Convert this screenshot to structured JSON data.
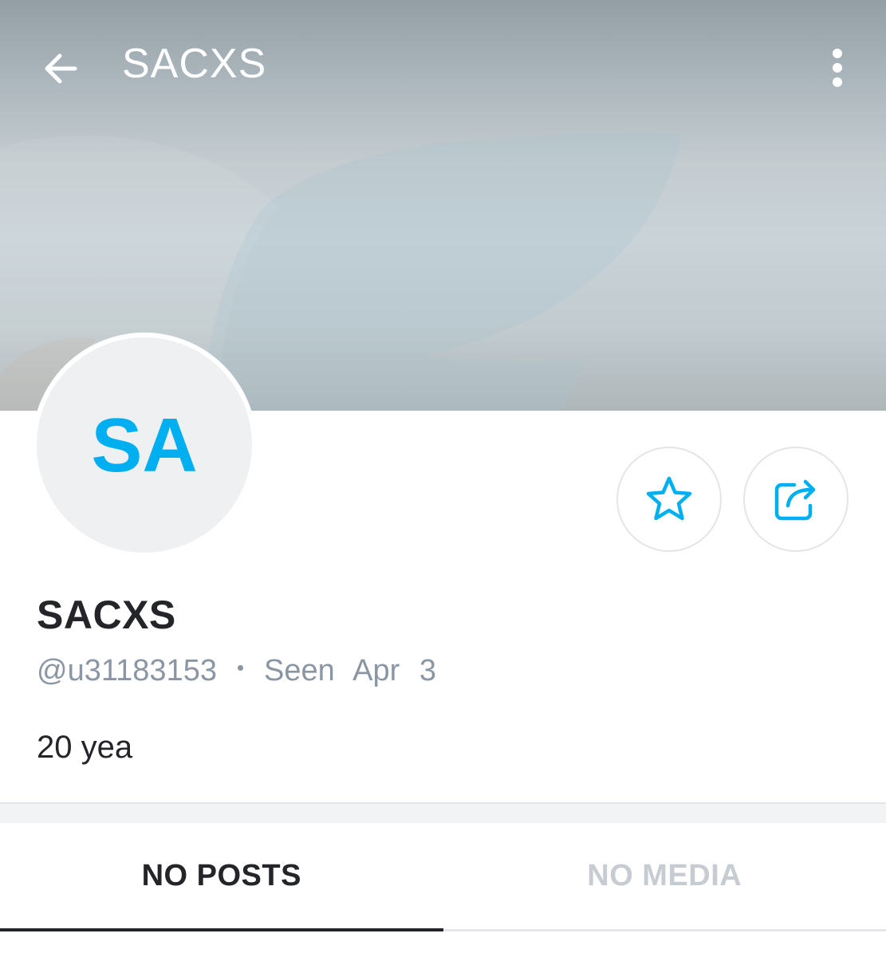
{
  "header": {
    "title": "SACXS",
    "back_icon": "arrow-left-icon",
    "more_icon": "more-vertical-icon"
  },
  "profile": {
    "initials": "SA",
    "display_name": "SACXS",
    "username": "@u31183153",
    "last_seen": "Seen Apr 3",
    "bio": "20 yea"
  },
  "actions": {
    "favorite_icon": "star-icon",
    "share_icon": "share-icon"
  },
  "tabs": [
    {
      "label": "NO POSTS",
      "active": true
    },
    {
      "label": "NO MEDIA",
      "active": false
    }
  ],
  "colors": {
    "accent": "#00aff0",
    "text_primary": "#242529",
    "text_secondary": "#8a96a3",
    "tab_inactive": "#c7ccd2"
  }
}
